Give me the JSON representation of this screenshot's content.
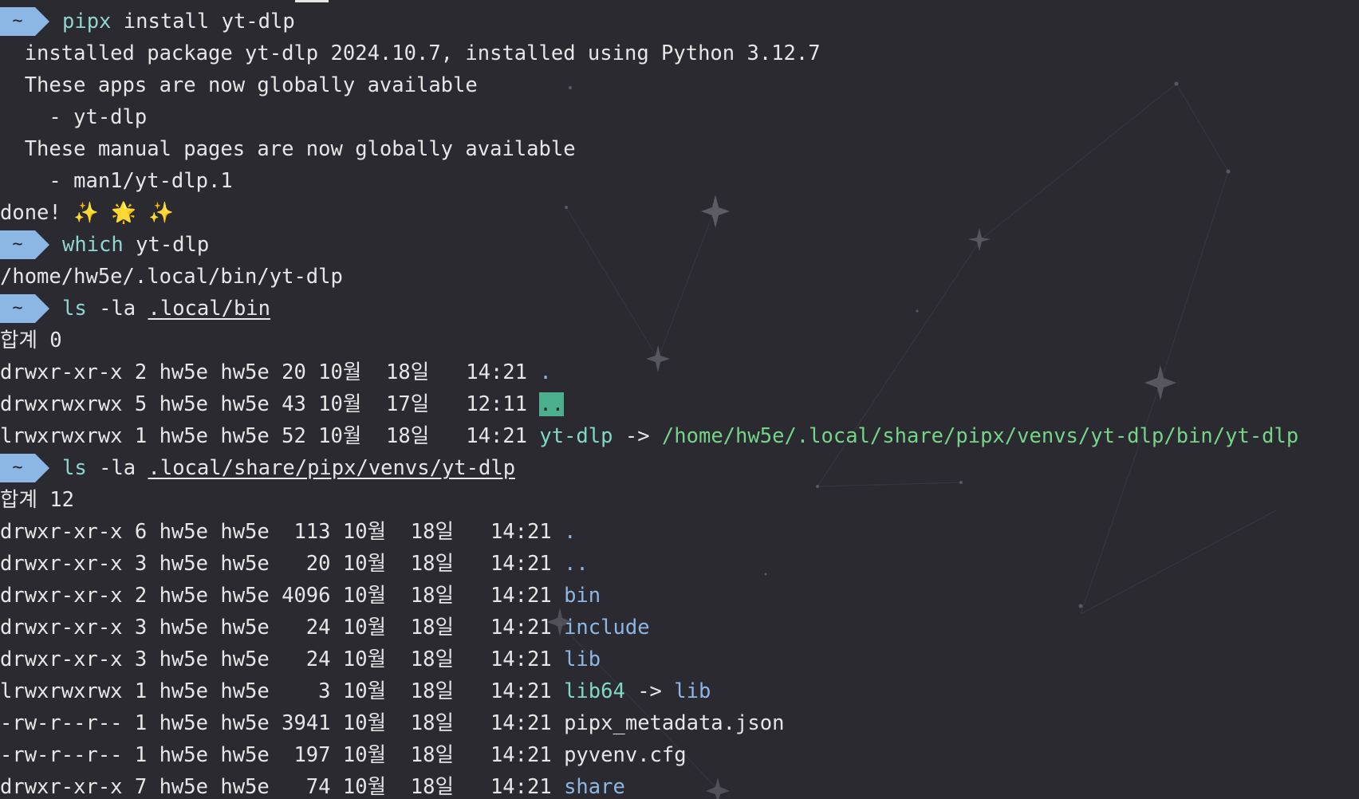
{
  "theme": {
    "background": "#2b2a31",
    "prompt_badge": "#8cb6e4",
    "command": "#8fd6cf",
    "directory": "#8cb6e4",
    "symlink": "#7fd9c3",
    "symlink_target": "#74d488",
    "highlight": "#4cb08e"
  },
  "prompt": {
    "path": "~"
  },
  "lines": [
    {
      "type": "prompt",
      "cmd": "pipx",
      "args": " install yt-dlp"
    },
    {
      "type": "text",
      "text": "  installed package yt-dlp 2024.10.7, installed using Python 3.12.7"
    },
    {
      "type": "text",
      "text": "  These apps are now globally available"
    },
    {
      "type": "text",
      "text": "    - yt-dlp"
    },
    {
      "type": "text",
      "text": "  These manual pages are now globally available"
    },
    {
      "type": "text",
      "text": "    - man1/yt-dlp.1"
    },
    {
      "type": "text",
      "text": "done! ✨ 🌟 ✨"
    },
    {
      "type": "prompt",
      "cmd": "which",
      "args": " yt-dlp"
    },
    {
      "type": "text",
      "text": "/home/hw5e/.local/bin/yt-dlp"
    },
    {
      "type": "prompt",
      "cmd": "ls",
      "args": " -la ",
      "path_arg": ".local/bin"
    },
    {
      "type": "total",
      "label": "합계",
      "value": " 0"
    },
    {
      "type": "entry",
      "meta": "drwxr-xr-x 2 hw5e hw5e 20 10월  18일   14:21 ",
      "name": ".",
      "kind": "dir"
    },
    {
      "type": "entry",
      "meta": "drwxrwxrwx 5 hw5e hw5e 43 10월  17일   12:11 ",
      "name": "..",
      "kind": "highlight"
    },
    {
      "type": "entry",
      "meta": "lrwxrwxrwx 1 hw5e hw5e 52 10월  18일   14:21 ",
      "name": "yt-dlp",
      "kind": "link",
      "arrow": " -> ",
      "target": "/home/hw5e/.local/share/pipx/venvs/yt-dlp/bin/yt-dlp",
      "target_kind": "target"
    },
    {
      "type": "prompt",
      "cmd": "ls",
      "args": " -la ",
      "path_arg": ".local/share/pipx/venvs/yt-dlp"
    },
    {
      "type": "total",
      "label": "합계",
      "value": " 12"
    },
    {
      "type": "entry",
      "meta": "drwxr-xr-x 6 hw5e hw5e  113 10월  18일   14:21 ",
      "name": ".",
      "kind": "dir"
    },
    {
      "type": "entry",
      "meta": "drwxr-xr-x 3 hw5e hw5e   20 10월  18일   14:21 ",
      "name": "..",
      "kind": "dir"
    },
    {
      "type": "entry",
      "meta": "drwxr-xr-x 2 hw5e hw5e 4096 10월  18일   14:21 ",
      "name": "bin",
      "kind": "dir"
    },
    {
      "type": "entry",
      "meta": "drwxr-xr-x 3 hw5e hw5e   24 10월  18일   14:21 ",
      "name": "include",
      "kind": "dir"
    },
    {
      "type": "entry",
      "meta": "drwxr-xr-x 3 hw5e hw5e   24 10월  18일   14:21 ",
      "name": "lib",
      "kind": "dir"
    },
    {
      "type": "entry",
      "meta": "lrwxrwxrwx 1 hw5e hw5e    3 10월  18일   14:21 ",
      "name": "lib64",
      "kind": "link",
      "arrow": " -> ",
      "target": "lib",
      "target_kind": "dir"
    },
    {
      "type": "entry",
      "meta": "-rw-r--r-- 1 hw5e hw5e 3941 10월  18일   14:21 ",
      "name": "pipx_metadata.json",
      "kind": "file"
    },
    {
      "type": "entry",
      "meta": "-rw-r--r-- 1 hw5e hw5e  197 10월  18일   14:21 ",
      "name": "pyvenv.cfg",
      "kind": "file"
    },
    {
      "type": "entry",
      "meta": "drwxr-xr-x 7 hw5e hw5e   74 10월  18일   14:21 ",
      "name": "share",
      "kind": "dir"
    }
  ]
}
